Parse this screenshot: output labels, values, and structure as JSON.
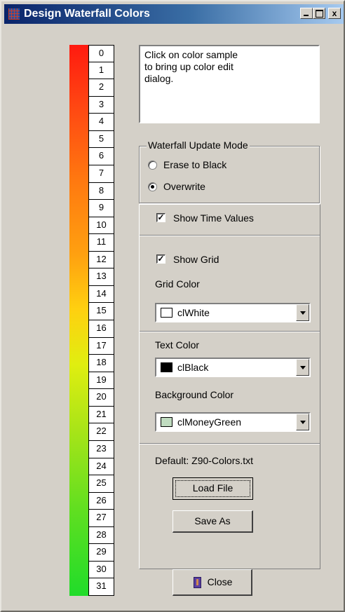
{
  "window": {
    "title": "Design Waterfall Colors",
    "minimize_label": "_",
    "maximize_label": "",
    "close_label": "x"
  },
  "colorbar": {
    "indices": [
      "0",
      "1",
      "2",
      "3",
      "4",
      "5",
      "6",
      "7",
      "8",
      "9",
      "10",
      "11",
      "12",
      "13",
      "14",
      "15",
      "16",
      "17",
      "18",
      "19",
      "20",
      "21",
      "22",
      "23",
      "24",
      "25",
      "26",
      "27",
      "28",
      "29",
      "30",
      "31"
    ],
    "gradient_colors": [
      "#ff1a10",
      "#ff7a10",
      "#ffd010",
      "#a8e418",
      "#20dc2a"
    ]
  },
  "info_text": "Click on color sample\nto bring up color edit\ndialog.",
  "update_mode": {
    "title": "Waterfall Update Mode",
    "options": [
      {
        "label": "Erase to Black",
        "checked": false
      },
      {
        "label": "Overwrite",
        "checked": true
      }
    ]
  },
  "time_values": {
    "label": "Show Time Values",
    "checked": true
  },
  "grid": {
    "show_label": "Show Grid",
    "checked": true,
    "color_label": "Grid Color",
    "color_value": "clWhite",
    "color_hex": "#ffffff"
  },
  "text_color": {
    "label": "Text Color",
    "value": "clBlack",
    "hex": "#000000"
  },
  "background_color": {
    "label": "Background Color",
    "value": "clMoneyGreen",
    "hex": "#c0dcc0"
  },
  "file": {
    "default_label": "Default: Z90-Colors.txt",
    "load_label": "Load File",
    "save_label": "Save As"
  },
  "close_button": {
    "label": "Close",
    "icon": "door-exit-icon"
  }
}
